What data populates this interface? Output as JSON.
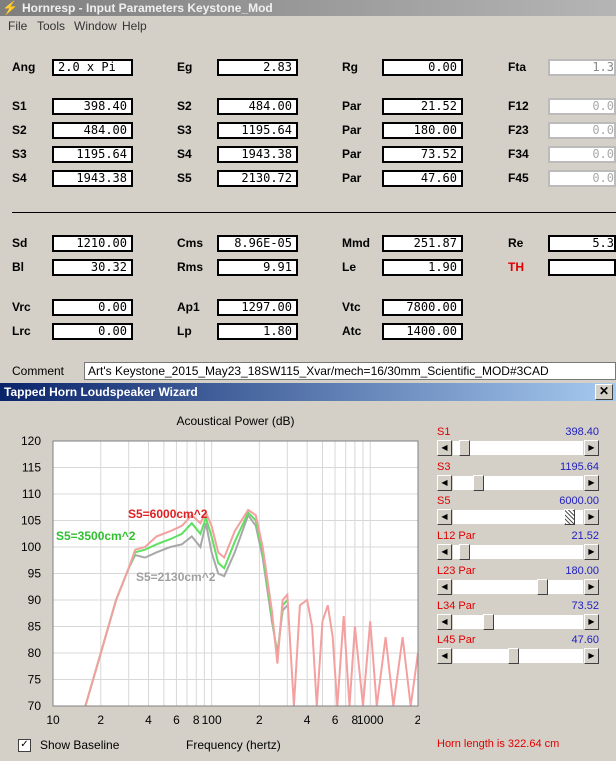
{
  "window": {
    "title": "Hornresp - Input Parameters   Keystone_Mod",
    "icon": "lightning-icon"
  },
  "menu": [
    "File",
    "Tools",
    "Window",
    "Help"
  ],
  "params": {
    "Ang": "2.0 x Pi",
    "Eg": "2.83",
    "Rg": "0.00",
    "Fta": "1.3",
    "S1a": "398.40",
    "S2a": "484.00",
    "Par1": "21.52",
    "F12": "0.0",
    "S2b": "484.00",
    "S3b": "1195.64",
    "Par2": "180.00",
    "F23": "0.0",
    "S3c": "1195.64",
    "S4c": "1943.38",
    "Par3": "73.52",
    "F34": "0.0",
    "S4d": "1943.38",
    "S5d": "2130.72",
    "Par4": "47.60",
    "F45": "0.0",
    "Sd": "1210.00",
    "Cms": "8.96E-05",
    "Mmd": "251.87",
    "Re": "5.3",
    "Bl": "30.32",
    "Rms": "9.91",
    "Le": "1.90",
    "TH": "",
    "Vrc": "0.00",
    "Ap1": "1297.00",
    "Vtc": "7800.00",
    "Lrc": "0.00",
    "Lp": "1.80",
    "Atc": "1400.00"
  },
  "labels": {
    "Ang": "Ang",
    "Eg": "Eg",
    "Rg": "Rg",
    "Fta": "Fta",
    "S1": "S1",
    "S2": "S2",
    "S3": "S3",
    "S4": "S4",
    "S5": "S5",
    "Par": "Par",
    "F12": "F12",
    "F23": "F23",
    "F34": "F34",
    "F45": "F45",
    "Sd": "Sd",
    "Cms": "Cms",
    "Mmd": "Mmd",
    "Re": "Re",
    "Bl": "Bl",
    "Rms": "Rms",
    "Le": "Le",
    "TH": "TH",
    "Vrc": "Vrc",
    "Ap1": "Ap1",
    "Vtc": "Vtc",
    "Lrc": "Lrc",
    "Lp": "Lp",
    "Atc": "Atc",
    "Comment": "Comment"
  },
  "comment": "Art's Keystone_2015_May23_18SW115_Xvar/mech=16/30mm_Scientific_MOD#3CAD",
  "wizard": {
    "title": "Tapped Horn Loudspeaker Wizard",
    "sliders": [
      {
        "label": "S1",
        "par": "",
        "value": "398.40",
        "pos": 0.05,
        "hatch": false
      },
      {
        "label": "S3",
        "par": "",
        "value": "1195.64",
        "pos": 0.17,
        "hatch": false
      },
      {
        "label": "S5",
        "par": "",
        "value": "6000.00",
        "pos": 0.93,
        "hatch": true
      },
      {
        "label": "L12",
        "par": "Par",
        "value": "21.52",
        "pos": 0.05,
        "hatch": false
      },
      {
        "label": "L23",
        "par": "Par",
        "value": "180.00",
        "pos": 0.71,
        "hatch": false
      },
      {
        "label": "L34",
        "par": "Par",
        "value": "73.52",
        "pos": 0.25,
        "hatch": false
      },
      {
        "label": "L45",
        "par": "Par",
        "value": "47.60",
        "pos": 0.46,
        "hatch": false
      }
    ],
    "show_baseline_label": "Show Baseline",
    "show_baseline_checked": true,
    "horn_length": "Horn length is 322.64 cm"
  },
  "chart_data": {
    "type": "line",
    "title": "Acoustical Power (dB)",
    "xlabel": "Frequency (hertz)",
    "ylabel": "",
    "xscale": "log",
    "xlim": [
      10,
      2000
    ],
    "ylim": [
      70,
      120
    ],
    "yticks": [
      70,
      75,
      80,
      85,
      90,
      95,
      100,
      105,
      110,
      115,
      120
    ],
    "xticks": [
      {
        "v": 10,
        "label": "10"
      },
      {
        "v": 20,
        "label": "2"
      },
      {
        "v": 40,
        "label": "4"
      },
      {
        "v": 60,
        "label": "6"
      },
      {
        "v": 80,
        "label": "8"
      },
      {
        "v": 100,
        "label": "100"
      },
      {
        "v": 200,
        "label": "2"
      },
      {
        "v": 400,
        "label": "4"
      },
      {
        "v": 600,
        "label": "6"
      },
      {
        "v": 800,
        "label": "8"
      },
      {
        "v": 1000,
        "label": "1000"
      },
      {
        "v": 2000,
        "label": "2"
      }
    ],
    "grid": true,
    "series": [
      {
        "name": "S5=6000cm^2",
        "color": "#f4a0a0",
        "labelColor": "#e02020",
        "points": [
          [
            16,
            70
          ],
          [
            20,
            80
          ],
          [
            25,
            90
          ],
          [
            30,
            96
          ],
          [
            33,
            99.5
          ],
          [
            38,
            100
          ],
          [
            45,
            102
          ],
          [
            55,
            103
          ],
          [
            65,
            104
          ],
          [
            75,
            106
          ],
          [
            85,
            104.5
          ],
          [
            92,
            106.5
          ],
          [
            100,
            104
          ],
          [
            110,
            99
          ],
          [
            120,
            98
          ],
          [
            140,
            103
          ],
          [
            170,
            107
          ],
          [
            190,
            106
          ],
          [
            210,
            100
          ],
          [
            240,
            88
          ],
          [
            260,
            78
          ],
          [
            280,
            90
          ],
          [
            300,
            91
          ],
          [
            330,
            70
          ],
          [
            360,
            89
          ],
          [
            400,
            90
          ],
          [
            430,
            85
          ],
          [
            460,
            70
          ],
          [
            500,
            86
          ],
          [
            540,
            89
          ],
          [
            580,
            83
          ],
          [
            620,
            70
          ],
          [
            680,
            87
          ],
          [
            740,
            70
          ],
          [
            800,
            85
          ],
          [
            900,
            70
          ],
          [
            1000,
            86
          ],
          [
            1100,
            70
          ],
          [
            1250,
            83
          ],
          [
            1400,
            70
          ],
          [
            1600,
            83
          ],
          [
            1800,
            70
          ],
          [
            2000,
            80
          ]
        ]
      },
      {
        "name": "S5=3500cm^2",
        "color": "#60e060",
        "labelColor": "#30c030",
        "points": [
          [
            16,
            70
          ],
          [
            20,
            80
          ],
          [
            25,
            90
          ],
          [
            30,
            96
          ],
          [
            33,
            99
          ],
          [
            38,
            99.5
          ],
          [
            45,
            100.5
          ],
          [
            55,
            101.5
          ],
          [
            65,
            102.5
          ],
          [
            75,
            104.5
          ],
          [
            85,
            102.5
          ],
          [
            92,
            105.5
          ],
          [
            100,
            102
          ],
          [
            110,
            97
          ],
          [
            120,
            96
          ],
          [
            140,
            101
          ],
          [
            170,
            106.5
          ],
          [
            190,
            105
          ],
          [
            210,
            99
          ],
          [
            240,
            87
          ],
          [
            260,
            79
          ],
          [
            280,
            89
          ],
          [
            300,
            90
          ]
        ]
      },
      {
        "name": "S5=2130cm^2",
        "color": "#a8a8a8",
        "labelColor": "#a0a0a0",
        "points": [
          [
            16,
            70
          ],
          [
            20,
            80
          ],
          [
            25,
            90
          ],
          [
            30,
            96
          ],
          [
            33,
            98.5
          ],
          [
            38,
            98
          ],
          [
            45,
            99
          ],
          [
            55,
            100
          ],
          [
            65,
            100.5
          ],
          [
            75,
            102
          ],
          [
            85,
            100
          ],
          [
            92,
            104.5
          ],
          [
            100,
            99
          ],
          [
            110,
            95
          ],
          [
            120,
            94.5
          ],
          [
            140,
            99
          ],
          [
            170,
            106
          ],
          [
            190,
            104
          ],
          [
            210,
            98
          ],
          [
            240,
            86
          ],
          [
            260,
            80
          ],
          [
            280,
            88
          ],
          [
            300,
            89
          ]
        ]
      }
    ]
  }
}
